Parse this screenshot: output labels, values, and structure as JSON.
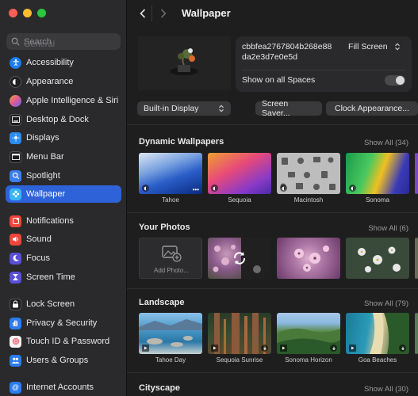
{
  "sidebar": {
    "search_placeholder": "Search",
    "search_ghost": "General",
    "items": [
      {
        "label": "Accessibility",
        "color": "#1a7cf5"
      },
      {
        "label": "Appearance",
        "color": "#1c1c1e"
      },
      {
        "label": "Apple Intelligence & Siri",
        "color": "#e0589a"
      },
      {
        "label": "Desktop & Dock",
        "color": "#1c1c1e"
      },
      {
        "label": "Displays",
        "color": "#2b8cf0"
      },
      {
        "label": "Menu Bar",
        "color": "#1c1c1e"
      },
      {
        "label": "Spotlight",
        "color": "#3a7ef0"
      },
      {
        "label": "Wallpaper",
        "color": "#38b5f5"
      },
      {
        "label": "Notifications",
        "color": "#f0453a"
      },
      {
        "label": "Sound",
        "color": "#f0453a"
      },
      {
        "label": "Focus",
        "color": "#5a4fd8"
      },
      {
        "label": "Screen Time",
        "color": "#5a4fd8"
      },
      {
        "label": "Lock Screen",
        "color": "#1c1c1e"
      },
      {
        "label": "Privacy & Security",
        "color": "#2b7cf0"
      },
      {
        "label": "Touch ID & Password",
        "color": "#f06070"
      },
      {
        "label": "Users & Groups",
        "color": "#2b7cf0"
      },
      {
        "label": "Internet Accounts",
        "color": "#2b7cf0"
      }
    ]
  },
  "header": {
    "title": "Wallpaper"
  },
  "current": {
    "name_line1": "cbbfea2767804b268e88",
    "name_line2": "da2e3d7e0e5d",
    "fill_label": "Fill Screen",
    "spaces_label": "Show on all Spaces",
    "spaces_on": false
  },
  "controls": {
    "display_label": "Built-in Display",
    "screensaver_label": "Screen Saver...",
    "clock_label": "Clock Appearance..."
  },
  "sections": {
    "dynamic": {
      "title": "Dynamic Wallpapers",
      "show_all": "Show All (34)",
      "items": [
        {
          "label": "Tahoe",
          "colors": [
            "#d8e6f0",
            "#2a5ec8",
            "#0a2a80"
          ]
        },
        {
          "label": "Sequoia",
          "colors": [
            "#e84a7a",
            "#6a38c8",
            "#f09040"
          ]
        },
        {
          "label": "Macintosh",
          "colors": [
            "#c8c8c8",
            "#9a9a9a",
            "#dcdcdc"
          ]
        },
        {
          "label": "Sonoma",
          "colors": [
            "#2aa850",
            "#f0c020",
            "#4a3ab8"
          ]
        }
      ]
    },
    "photos": {
      "title": "Your Photos",
      "show_all": "Show All (6)",
      "add_label": "Add Photo...",
      "items": [
        {
          "colors": [
            "#6a4a6a",
            "#a87aa0",
            "#3a4a2a"
          ]
        },
        {
          "colors": [
            "#a878a0",
            "#d8a8c8",
            "#5a3a5a"
          ]
        },
        {
          "colors": [
            "#3a4a3a",
            "#e8e8e8",
            "#6a7a5a"
          ]
        }
      ]
    },
    "landscape": {
      "title": "Landscape",
      "show_all": "Show All (79)",
      "items": [
        {
          "label": "Tahoe Day",
          "colors": [
            "#6aa8d8",
            "#2a88b8",
            "#c8d8e0"
          ]
        },
        {
          "label": "Sequoia Sunrise",
          "colors": [
            "#3a5a3a",
            "#a86a3a",
            "#2a3a2a"
          ]
        },
        {
          "label": "Sonoma Horizon",
          "colors": [
            "#8ab8e0",
            "#4a8a4a",
            "#2a5a2a"
          ]
        },
        {
          "label": "Goa Beaches",
          "colors": [
            "#2a9ab8",
            "#d8c89a",
            "#3a6a3a"
          ]
        }
      ]
    },
    "cityscape": {
      "title": "Cityscape",
      "show_all": "Show All (30)"
    }
  }
}
